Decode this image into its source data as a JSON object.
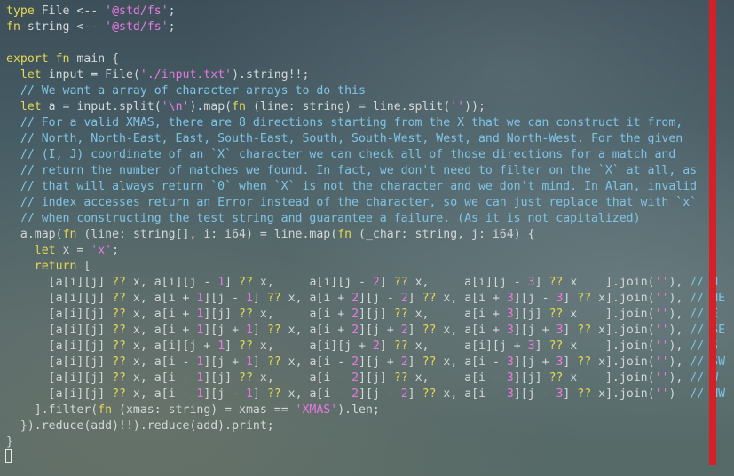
{
  "editor": {
    "lines": [
      [
        {
          "t": "type",
          "c": "kw"
        },
        {
          "t": " File <-- ",
          "c": "fn"
        },
        {
          "t": "'@std/fs'",
          "c": "str"
        },
        {
          "t": ";",
          "c": "fn"
        }
      ],
      [
        {
          "t": "fn",
          "c": "kw"
        },
        {
          "t": " string <-- ",
          "c": "fn"
        },
        {
          "t": "'@std/fs'",
          "c": "str"
        },
        {
          "t": ";",
          "c": "fn"
        }
      ],
      [],
      [
        {
          "t": "export",
          "c": "kw"
        },
        {
          "t": " ",
          "c": "fn"
        },
        {
          "t": "fn",
          "c": "kw"
        },
        {
          "t": " main {",
          "c": "fn"
        }
      ],
      [
        {
          "t": "  ",
          "c": "fn"
        },
        {
          "t": "let",
          "c": "kw"
        },
        {
          "t": " input = File(",
          "c": "fn"
        },
        {
          "t": "'./input.txt'",
          "c": "str"
        },
        {
          "t": ").string!!;",
          "c": "fn"
        }
      ],
      [
        {
          "t": "  // We want a array of character arrays to do this",
          "c": "cm"
        }
      ],
      [
        {
          "t": "  ",
          "c": "fn"
        },
        {
          "t": "let",
          "c": "kw"
        },
        {
          "t": " a = input.split(",
          "c": "fn"
        },
        {
          "t": "'\\n'",
          "c": "str"
        },
        {
          "t": ").map(",
          "c": "fn"
        },
        {
          "t": "fn",
          "c": "kw"
        },
        {
          "t": " (line: string) = line.split(",
          "c": "fn"
        },
        {
          "t": "''",
          "c": "str"
        },
        {
          "t": "));",
          "c": "fn"
        }
      ],
      [
        {
          "t": "  // For a valid XMAS, there are 8 directions starting from the X that we can construct it from,",
          "c": "cm"
        }
      ],
      [
        {
          "t": "  // North, North-East, East, South-East, South, South-West, West, and North-West. For the given",
          "c": "cm"
        }
      ],
      [
        {
          "t": "  // (I, J) coordinate of an `X` character we can check all of those directions for a match and",
          "c": "cm"
        }
      ],
      [
        {
          "t": "  // return the number of matches we found. In fact, we don't need to filter on the `X` at all, as",
          "c": "cm"
        }
      ],
      [
        {
          "t": "  // that will always return `0` when `X` is not the character and we don't mind. In Alan, invalid",
          "c": "cm"
        }
      ],
      [
        {
          "t": "  // index accesses return an Error instead of the character, so we can just replace that with `x`",
          "c": "cm"
        }
      ],
      [
        {
          "t": "  // when constructing the test string and guarantee a failure. (As it is not capitalized)",
          "c": "cm"
        }
      ],
      [
        {
          "t": "  a.map(",
          "c": "fn"
        },
        {
          "t": "fn",
          "c": "kw"
        },
        {
          "t": " (line: string[], i: i64) = line.map(",
          "c": "fn"
        },
        {
          "t": "fn",
          "c": "kw"
        },
        {
          "t": " (_char: string, j: i64) {",
          "c": "fn"
        }
      ],
      [
        {
          "t": "    ",
          "c": "fn"
        },
        {
          "t": "let",
          "c": "kw"
        },
        {
          "t": " x = ",
          "c": "fn"
        },
        {
          "t": "'x'",
          "c": "str"
        },
        {
          "t": ";",
          "c": "fn"
        }
      ],
      [
        {
          "t": "    ",
          "c": "fn"
        },
        {
          "t": "return",
          "c": "kw"
        },
        {
          "t": " [",
          "c": "fn"
        }
      ],
      [
        {
          "t": "      [a[i][j] ",
          "c": "fn"
        },
        {
          "t": "??",
          "c": "kw"
        },
        {
          "t": " x, a[i][j - ",
          "c": "fn"
        },
        {
          "t": "1",
          "c": "str"
        },
        {
          "t": "] ",
          "c": "fn"
        },
        {
          "t": "??",
          "c": "kw"
        },
        {
          "t": " x,     a[i][j - ",
          "c": "fn"
        },
        {
          "t": "2",
          "c": "str"
        },
        {
          "t": "] ",
          "c": "fn"
        },
        {
          "t": "??",
          "c": "kw"
        },
        {
          "t": " x,     a[i][j - ",
          "c": "fn"
        },
        {
          "t": "3",
          "c": "str"
        },
        {
          "t": "] ",
          "c": "fn"
        },
        {
          "t": "??",
          "c": "kw"
        },
        {
          "t": " x    ].join(",
          "c": "fn"
        },
        {
          "t": "''",
          "c": "str"
        },
        {
          "t": "), ",
          "c": "fn"
        },
        {
          "t": "// N",
          "c": "cm"
        }
      ],
      [
        {
          "t": "      [a[i][j] ",
          "c": "fn"
        },
        {
          "t": "??",
          "c": "kw"
        },
        {
          "t": " x, a[i + ",
          "c": "fn"
        },
        {
          "t": "1",
          "c": "str"
        },
        {
          "t": "][j - ",
          "c": "fn"
        },
        {
          "t": "1",
          "c": "str"
        },
        {
          "t": "] ",
          "c": "fn"
        },
        {
          "t": "??",
          "c": "kw"
        },
        {
          "t": " x, a[i + ",
          "c": "fn"
        },
        {
          "t": "2",
          "c": "str"
        },
        {
          "t": "][j - ",
          "c": "fn"
        },
        {
          "t": "2",
          "c": "str"
        },
        {
          "t": "] ",
          "c": "fn"
        },
        {
          "t": "??",
          "c": "kw"
        },
        {
          "t": " x, a[i + ",
          "c": "fn"
        },
        {
          "t": "3",
          "c": "str"
        },
        {
          "t": "][j - ",
          "c": "fn"
        },
        {
          "t": "3",
          "c": "str"
        },
        {
          "t": "] ",
          "c": "fn"
        },
        {
          "t": "??",
          "c": "kw"
        },
        {
          "t": " x].join(",
          "c": "fn"
        },
        {
          "t": "''",
          "c": "str"
        },
        {
          "t": "), ",
          "c": "fn"
        },
        {
          "t": "// NE",
          "c": "cm"
        }
      ],
      [
        {
          "t": "      [a[i][j] ",
          "c": "fn"
        },
        {
          "t": "??",
          "c": "kw"
        },
        {
          "t": " x, a[i + ",
          "c": "fn"
        },
        {
          "t": "1",
          "c": "str"
        },
        {
          "t": "][j] ",
          "c": "fn"
        },
        {
          "t": "??",
          "c": "kw"
        },
        {
          "t": " x,     a[i + ",
          "c": "fn"
        },
        {
          "t": "2",
          "c": "str"
        },
        {
          "t": "][j] ",
          "c": "fn"
        },
        {
          "t": "??",
          "c": "kw"
        },
        {
          "t": " x,     a[i + ",
          "c": "fn"
        },
        {
          "t": "3",
          "c": "str"
        },
        {
          "t": "][j] ",
          "c": "fn"
        },
        {
          "t": "??",
          "c": "kw"
        },
        {
          "t": " x    ].join(",
          "c": "fn"
        },
        {
          "t": "''",
          "c": "str"
        },
        {
          "t": "), ",
          "c": "fn"
        },
        {
          "t": "// E",
          "c": "cm"
        }
      ],
      [
        {
          "t": "      [a[i][j] ",
          "c": "fn"
        },
        {
          "t": "??",
          "c": "kw"
        },
        {
          "t": " x, a[i + ",
          "c": "fn"
        },
        {
          "t": "1",
          "c": "str"
        },
        {
          "t": "][j + ",
          "c": "fn"
        },
        {
          "t": "1",
          "c": "str"
        },
        {
          "t": "] ",
          "c": "fn"
        },
        {
          "t": "??",
          "c": "kw"
        },
        {
          "t": " x, a[i + ",
          "c": "fn"
        },
        {
          "t": "2",
          "c": "str"
        },
        {
          "t": "][j + ",
          "c": "fn"
        },
        {
          "t": "2",
          "c": "str"
        },
        {
          "t": "] ",
          "c": "fn"
        },
        {
          "t": "??",
          "c": "kw"
        },
        {
          "t": " x, a[i + ",
          "c": "fn"
        },
        {
          "t": "3",
          "c": "str"
        },
        {
          "t": "][j + ",
          "c": "fn"
        },
        {
          "t": "3",
          "c": "str"
        },
        {
          "t": "] ",
          "c": "fn"
        },
        {
          "t": "??",
          "c": "kw"
        },
        {
          "t": " x].join(",
          "c": "fn"
        },
        {
          "t": "''",
          "c": "str"
        },
        {
          "t": "), ",
          "c": "fn"
        },
        {
          "t": "// SE",
          "c": "cm"
        }
      ],
      [
        {
          "t": "      [a[i][j] ",
          "c": "fn"
        },
        {
          "t": "??",
          "c": "kw"
        },
        {
          "t": " x, a[i][j + ",
          "c": "fn"
        },
        {
          "t": "1",
          "c": "str"
        },
        {
          "t": "] ",
          "c": "fn"
        },
        {
          "t": "??",
          "c": "kw"
        },
        {
          "t": " x,     a[i][j + ",
          "c": "fn"
        },
        {
          "t": "2",
          "c": "str"
        },
        {
          "t": "] ",
          "c": "fn"
        },
        {
          "t": "??",
          "c": "kw"
        },
        {
          "t": " x,     a[i][j + ",
          "c": "fn"
        },
        {
          "t": "3",
          "c": "str"
        },
        {
          "t": "] ",
          "c": "fn"
        },
        {
          "t": "??",
          "c": "kw"
        },
        {
          "t": " x    ].join(",
          "c": "fn"
        },
        {
          "t": "''",
          "c": "str"
        },
        {
          "t": "), ",
          "c": "fn"
        },
        {
          "t": "// S",
          "c": "cm"
        }
      ],
      [
        {
          "t": "      [a[i][j] ",
          "c": "fn"
        },
        {
          "t": "??",
          "c": "kw"
        },
        {
          "t": " x, a[i - ",
          "c": "fn"
        },
        {
          "t": "1",
          "c": "str"
        },
        {
          "t": "][j + ",
          "c": "fn"
        },
        {
          "t": "1",
          "c": "str"
        },
        {
          "t": "] ",
          "c": "fn"
        },
        {
          "t": "??",
          "c": "kw"
        },
        {
          "t": " x, a[i - ",
          "c": "fn"
        },
        {
          "t": "2",
          "c": "str"
        },
        {
          "t": "][j + ",
          "c": "fn"
        },
        {
          "t": "2",
          "c": "str"
        },
        {
          "t": "] ",
          "c": "fn"
        },
        {
          "t": "??",
          "c": "kw"
        },
        {
          "t": " x, a[i - ",
          "c": "fn"
        },
        {
          "t": "3",
          "c": "str"
        },
        {
          "t": "][j + ",
          "c": "fn"
        },
        {
          "t": "3",
          "c": "str"
        },
        {
          "t": "] ",
          "c": "fn"
        },
        {
          "t": "??",
          "c": "kw"
        },
        {
          "t": " x].join(",
          "c": "fn"
        },
        {
          "t": "''",
          "c": "str"
        },
        {
          "t": "), ",
          "c": "fn"
        },
        {
          "t": "// SW",
          "c": "cm"
        }
      ],
      [
        {
          "t": "      [a[i][j] ",
          "c": "fn"
        },
        {
          "t": "??",
          "c": "kw"
        },
        {
          "t": " x, a[i - ",
          "c": "fn"
        },
        {
          "t": "1",
          "c": "str"
        },
        {
          "t": "][j] ",
          "c": "fn"
        },
        {
          "t": "??",
          "c": "kw"
        },
        {
          "t": " x,     a[i - ",
          "c": "fn"
        },
        {
          "t": "2",
          "c": "str"
        },
        {
          "t": "][j] ",
          "c": "fn"
        },
        {
          "t": "??",
          "c": "kw"
        },
        {
          "t": " x,     a[i - ",
          "c": "fn"
        },
        {
          "t": "3",
          "c": "str"
        },
        {
          "t": "][j] ",
          "c": "fn"
        },
        {
          "t": "??",
          "c": "kw"
        },
        {
          "t": " x    ].join(",
          "c": "fn"
        },
        {
          "t": "''",
          "c": "str"
        },
        {
          "t": "), ",
          "c": "fn"
        },
        {
          "t": "// W",
          "c": "cm"
        }
      ],
      [
        {
          "t": "      [a[i][j] ",
          "c": "fn"
        },
        {
          "t": "??",
          "c": "kw"
        },
        {
          "t": " x, a[i - ",
          "c": "fn"
        },
        {
          "t": "1",
          "c": "str"
        },
        {
          "t": "][j - ",
          "c": "fn"
        },
        {
          "t": "1",
          "c": "str"
        },
        {
          "t": "] ",
          "c": "fn"
        },
        {
          "t": "??",
          "c": "kw"
        },
        {
          "t": " x, a[i - ",
          "c": "fn"
        },
        {
          "t": "2",
          "c": "str"
        },
        {
          "t": "][j - ",
          "c": "fn"
        },
        {
          "t": "2",
          "c": "str"
        },
        {
          "t": "] ",
          "c": "fn"
        },
        {
          "t": "??",
          "c": "kw"
        },
        {
          "t": " x, a[i - ",
          "c": "fn"
        },
        {
          "t": "3",
          "c": "str"
        },
        {
          "t": "][j - ",
          "c": "fn"
        },
        {
          "t": "3",
          "c": "str"
        },
        {
          "t": "] ",
          "c": "fn"
        },
        {
          "t": "??",
          "c": "kw"
        },
        {
          "t": " x].join(",
          "c": "fn"
        },
        {
          "t": "''",
          "c": "str"
        },
        {
          "t": ")  ",
          "c": "fn"
        },
        {
          "t": "// NW",
          "c": "cm"
        }
      ],
      [
        {
          "t": "    ].filter(",
          "c": "fn"
        },
        {
          "t": "fn",
          "c": "kw"
        },
        {
          "t": " (xmas: string) = xmas == ",
          "c": "fn"
        },
        {
          "t": "'XMAS'",
          "c": "str"
        },
        {
          "t": ").len;",
          "c": "fn"
        }
      ],
      [
        {
          "t": "  }).reduce(add)!!).reduce(add).print;",
          "c": "fn"
        }
      ],
      [
        {
          "t": "}",
          "c": "fn"
        }
      ]
    ]
  },
  "colors": {
    "keyword": "#e6d652",
    "string": "#e77ae0",
    "comment": "#7fc4e6",
    "text": "#d2d7d9",
    "scroll_marker": "#d62027"
  }
}
